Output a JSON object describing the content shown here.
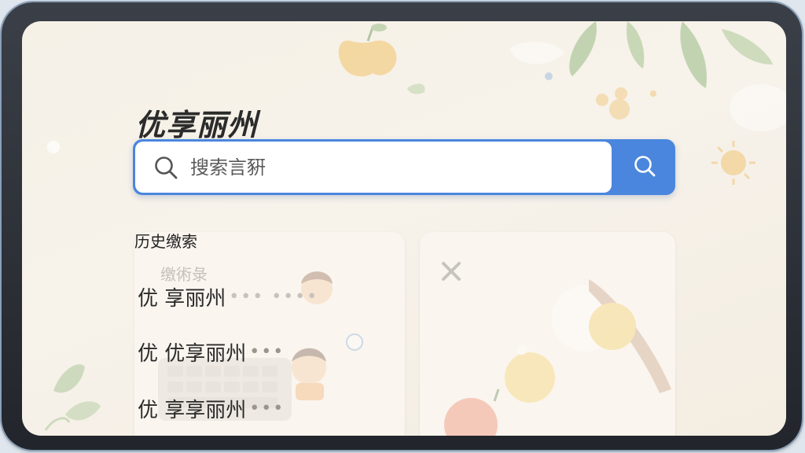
{
  "page_title": "优享丽州",
  "search": {
    "placeholder": "搜索言豣"
  },
  "history": {
    "label": "历史缴索",
    "faded_label": "缴術彔",
    "items": [
      {
        "text": "优 享丽州",
        "dots": "••• ••••"
      },
      {
        "text": "优 优享丽州",
        "dots": "•••"
      },
      {
        "text": "优 享享丽州",
        "dots": "•••"
      }
    ]
  },
  "colors": {
    "accent": "#4a86de",
    "background": "#f6f1e7",
    "bezel": "#2c2f36"
  }
}
